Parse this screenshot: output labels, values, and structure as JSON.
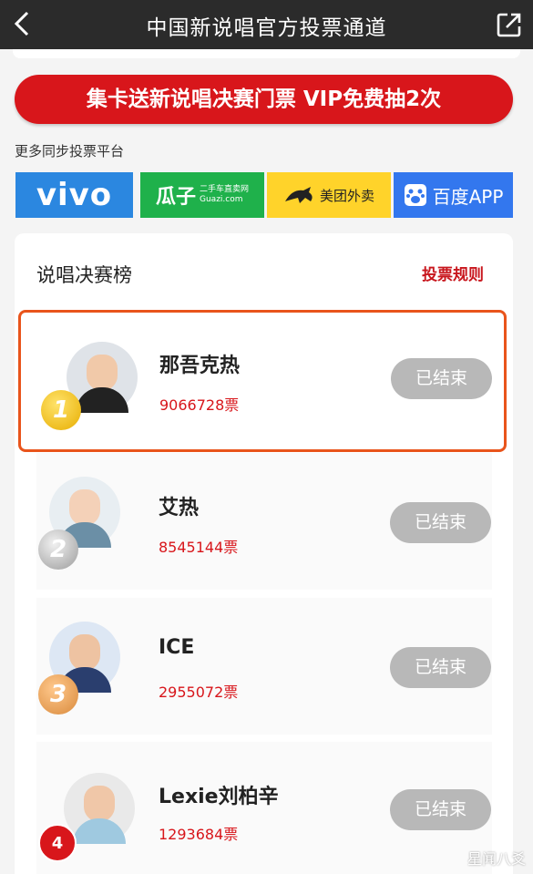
{
  "topbar": {
    "title": "中国新说唱官方投票通道",
    "back_icon": "back-chevron-icon",
    "share_icon": "share-icon"
  },
  "promo": {
    "label": "集卡送新说唱决赛门票 VIP免费抽2次"
  },
  "platforms": {
    "label": "更多同步投票平台",
    "items": [
      {
        "name": "vivo",
        "text": "vivo"
      },
      {
        "name": "guazi",
        "text": "瓜子",
        "sub1": "二手车直卖网",
        "sub2": "Guazi.com"
      },
      {
        "name": "meituan",
        "text": "美团外卖"
      },
      {
        "name": "baidu",
        "text": "百度APP"
      }
    ]
  },
  "board": {
    "title": "说唱决赛榜",
    "rules_link": "投票规则"
  },
  "rankings": [
    {
      "rank": "1",
      "name": "那吾克热",
      "votes": "9066728票",
      "status": "已结束"
    },
    {
      "rank": "2",
      "name": "艾热",
      "votes": "8545144票",
      "status": "已结束"
    },
    {
      "rank": "3",
      "name": "ICE",
      "votes": "2955072票",
      "status": "已结束"
    },
    {
      "rank": "4",
      "name": "Lexie刘柏辛",
      "votes": "1293684票",
      "status": "已结束"
    }
  ],
  "watermark": "星闻八爻",
  "colors": {
    "accent_red": "#d8161b",
    "highlight_border": "#e9541b",
    "topbar": "#2b2b2b"
  }
}
